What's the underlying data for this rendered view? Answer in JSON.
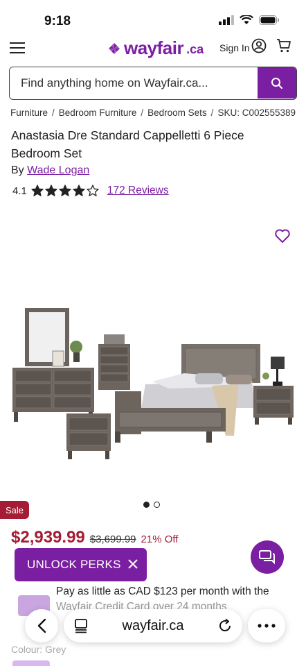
{
  "status_bar": {
    "time": "9:18"
  },
  "header": {
    "logo": "wayfair",
    "logo_suffix": ".ca",
    "sign_in": "Sign In"
  },
  "search": {
    "placeholder": "Find anything home on Wayfair.ca..."
  },
  "breadcrumb": {
    "items": [
      "Furniture",
      "Bedroom Furniture",
      "Bedroom Sets"
    ],
    "sku": "SKU: C002555389"
  },
  "product": {
    "title": "Anastasia Dre Standard Cappelletti 6 Piece Bedroom Set",
    "by_label": "By",
    "brand": "Wade Logan",
    "rating_value": "4.1",
    "rating_stars": 4.1,
    "reviews": "172 Reviews",
    "image_count": 2,
    "image_active": 1
  },
  "pricing": {
    "sale_badge": "Sale",
    "price": "$2,939.99",
    "old_price": "$3,699.99",
    "discount": "21% Off"
  },
  "promo": {
    "unlock_perks": "UNLOCK PERKS"
  },
  "financing": {
    "line1": "Pay as little as CAD $123 per month with the",
    "line2": "Wayfair Credit Card over 24 months"
  },
  "options": {
    "color_label": "Colour: Grey"
  },
  "browser": {
    "url": "wayfair.ca"
  },
  "colors": {
    "brand_purple": "#7b1fa2",
    "sale_red": "#a51d34"
  }
}
